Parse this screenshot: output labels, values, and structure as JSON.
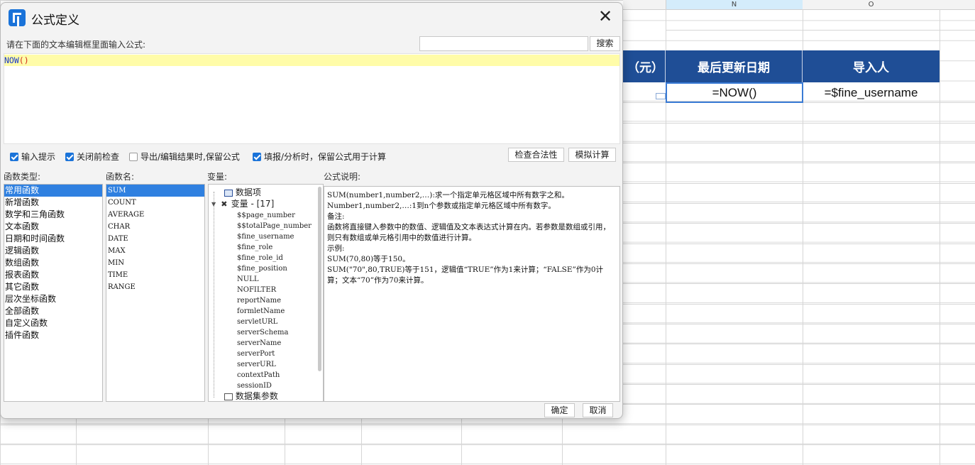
{
  "spreadsheet": {
    "columns": [
      {
        "letter": "N"
      },
      {
        "letter": "O"
      }
    ],
    "header_cells": [
      "（元）",
      "最后更新日期",
      "导入人"
    ],
    "data_cells": [
      "=NOW()",
      "=$fine_username"
    ]
  },
  "dialog": {
    "title": "公式定义",
    "prompt_label": "请在下面的文本编辑框里面输入公式:",
    "search": {
      "value": "",
      "button_label": "搜索"
    },
    "formula": {
      "name": "NOW",
      "parens": "()"
    },
    "options": [
      {
        "label": "输入提示",
        "checked": true
      },
      {
        "label": "关闭前检查",
        "checked": true
      },
      {
        "label": "导出/编辑结果时,保留公式",
        "checked": false
      },
      {
        "label": "填报/分析时，保留公式用于计算",
        "checked": true
      }
    ],
    "check_button": "检查合法性",
    "simulate_button": "模拟计算",
    "func_type_label": "函数类型:",
    "func_name_label": "函数名:",
    "variable_label": "变量:",
    "desc_label": "公式说明:",
    "func_types": [
      "常用函数",
      "新增函数",
      "数学和三角函数",
      "文本函数",
      "日期和时间函数",
      "逻辑函数",
      "数组函数",
      "报表函数",
      "其它函数",
      "层次坐标函数",
      "全部函数",
      "自定义函数",
      "插件函数"
    ],
    "selected_func_type": "常用函数",
    "func_names": [
      "SUM",
      "COUNT",
      "AVERAGE",
      "CHAR",
      "DATE",
      "MAX",
      "MIN",
      "TIME",
      "RANGE"
    ],
    "selected_func_name": "SUM",
    "variables": {
      "data_item": "数据项",
      "var_group": "变量 - [17]",
      "var_items": [
        "$$page_number",
        "$$totalPage_number",
        "$fine_username",
        "$fine_role",
        "$fine_role_id",
        "$fine_position",
        "NULL",
        "NOFILTER",
        "reportName",
        "formletName",
        "servletURL",
        "serverSchema",
        "serverName",
        "serverPort",
        "serverURL",
        "contextPath",
        "sessionID"
      ],
      "dataset_params": "数据集参数"
    },
    "description": "SUM(number1,number2,…):求一个指定单元格区域中所有数字之和。\nNumber1,number2,…:1到n个参数或指定单元格区域中所有数字。\n备注:\n函数将直接键入参数中的数值、逻辑值及文本表达式计算在内。若参数是数组或引用，则只有数组或单元格引用中的数值进行计算。\n示例:\nSUM(70,80)等于150。\nSUM(\"70\",80,TRUE)等于151，逻辑值“TRUE”作为1来计算；“FALSE”作为0计算；文本“70”作为70来计算。",
    "ok_button": "确定",
    "cancel_button": "取消"
  }
}
